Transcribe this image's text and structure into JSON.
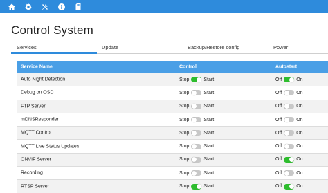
{
  "nav": {
    "icons": [
      "home-icon",
      "gear-icon",
      "tools-icon",
      "info-icon",
      "sd-card-icon"
    ]
  },
  "page": {
    "title": "Control System"
  },
  "tabs": [
    "Services",
    "Update",
    "Backup/Restore config",
    "Power"
  ],
  "table": {
    "headers": {
      "name": "Service Name",
      "control": "Control",
      "autostart": "Autostart"
    },
    "labels": {
      "stop": "Stop",
      "start": "Start",
      "off": "Off",
      "on": "On"
    },
    "rows": [
      {
        "name": "Auto Night Detection",
        "running": true,
        "autostart": true
      },
      {
        "name": "Debug on OSD",
        "running": false,
        "autostart": false
      },
      {
        "name": "FTP Server",
        "running": false,
        "autostart": false
      },
      {
        "name": "mDNSResponder",
        "running": false,
        "autostart": false
      },
      {
        "name": "MQTT Control",
        "running": false,
        "autostart": false
      },
      {
        "name": "MQTT Live Status Updates",
        "running": false,
        "autostart": false
      },
      {
        "name": "ONVIF Server",
        "running": false,
        "autostart": true
      },
      {
        "name": "Recording",
        "running": false,
        "autostart": false
      },
      {
        "name": "RTSP Server",
        "running": true,
        "autostart": true
      }
    ]
  },
  "colors": {
    "accent": "#2e8bdc",
    "header": "#4a9fe6",
    "toggle_on": "#2ebd2e",
    "toggle_off": "#c8c8c8"
  }
}
